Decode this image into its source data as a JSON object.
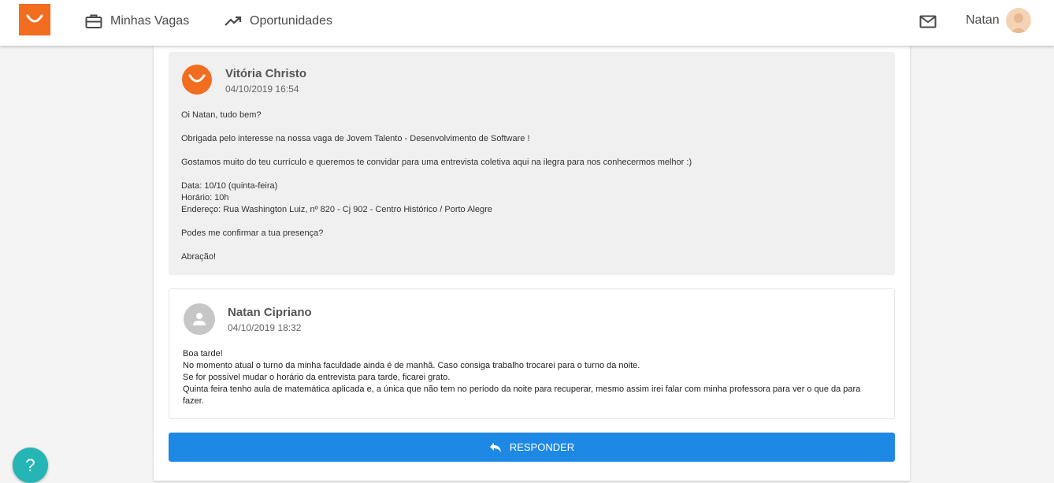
{
  "nav": {
    "vagas_label": "Minhas Vagas",
    "oportunidades_label": "Oportunidades",
    "user_name": "Natan"
  },
  "colors": {
    "brand": "#f26d1f",
    "reply_button": "#1e88e5",
    "help_button": "#26b5b5"
  },
  "messages": [
    {
      "sender": "Vitória Christo",
      "date": "04/10/2019 16:54",
      "avatar_icon": "company-logo-icon",
      "paragraphs": [
        [
          "Oi Natan, tudo bem?"
        ],
        [
          "Obrigada pelo interesse na nossa vaga de Jovem Talento - Desenvolvimento de Software !"
        ],
        [
          "Gostamos muito do teu currículo e queremos te convidar para uma entrevista coletiva aqui na ilegra para nos conhecermos melhor :)"
        ],
        [
          "Data: 10/10 (quinta-feira)",
          "Horário: 10h",
          "Endereço: Rua Washington Luiz, nº 820 - Cj 902 - Centro Histórico / Porto Alegre"
        ],
        [
          "Podes me confirmar a tua presença?"
        ],
        [
          "Abração!"
        ]
      ]
    },
    {
      "sender": "Natan Cipriano",
      "date": "04/10/2019 18:32",
      "avatar_icon": "person-icon",
      "lines": [
        "Boa tarde!",
        "No momento atual o turno da minha faculdade ainda é de manhã. Caso consiga trabalho trocarei para o turno da noite.",
        "Se for possível mudar o horário da entrevista para tarde, ficarei grato.",
        "Quinta feira tenho aula de matemática aplicada e, a única que não tem no período da noite para recuperar, mesmo assim irei falar com minha professora para ver o que da para fazer."
      ]
    }
  ],
  "reply_label": "RESPONDER",
  "help_label": "?"
}
